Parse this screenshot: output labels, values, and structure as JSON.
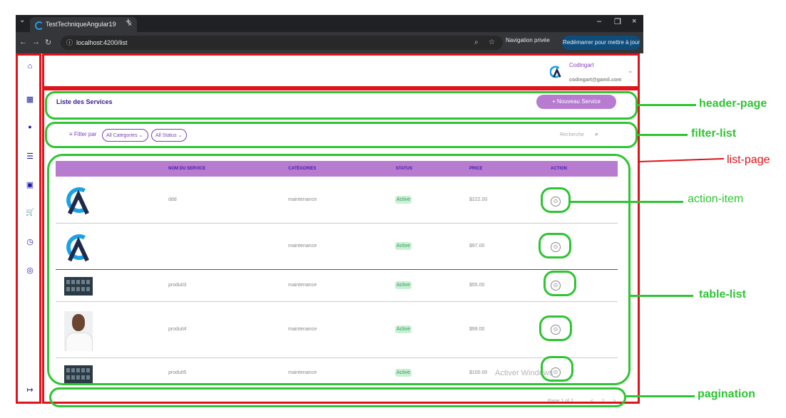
{
  "browser": {
    "tab_title": "TestTechniqueAngular19",
    "tab_menu": "⌄",
    "tab_close": "×",
    "new_tab": "+",
    "win_min": "–",
    "win_restore": "❐",
    "win_close": "×",
    "url": "localhost:4200/list",
    "back": "←",
    "forward": "→",
    "reload": "↻",
    "zoom": "⌕",
    "star": "☆",
    "private_label": "Navigation privée",
    "restart_label": "Redémarrer pour mettre à jour ⋮"
  },
  "sidebar": {
    "icons": [
      "home-icon",
      "dashboard-icon",
      "user-icon",
      "list-icon",
      "gallery-icon",
      "cart-icon",
      "clock-icon",
      "fingerprint-icon",
      "logout-icon"
    ],
    "glyphs": [
      "⌂",
      "▦",
      "●",
      "☰",
      "▣",
      "🛒",
      "◷",
      "◎",
      "↦"
    ]
  },
  "user": {
    "name": "Codingart",
    "email": "codingart@gamil.com",
    "chevron": "⌄"
  },
  "header": {
    "title": "Liste des Services",
    "new_button": "+ Nouveau Service"
  },
  "filters": {
    "label": "Filter par",
    "category": "All Categories",
    "status": "All Status",
    "search_placeholder": "Recherche",
    "filter_glyph": "≡",
    "search_glyph": "⌕"
  },
  "table": {
    "columns": [
      "NOM DU SERVICE",
      "CATÉGORIES",
      "STATUS",
      "PRICE",
      "ACTION"
    ],
    "rows": [
      {
        "image": "logo",
        "name": "ddd",
        "category": "maintenance",
        "status": "Active",
        "price": "$222.00"
      },
      {
        "image": "logo",
        "name": "",
        "category": "maintenance",
        "status": "Active",
        "price": "$97.00"
      },
      {
        "image": "screenshot",
        "name": "produit3",
        "category": "maintenance",
        "status": "Active",
        "price": "$55.00"
      },
      {
        "image": "person",
        "name": "produit4",
        "category": "maintenance",
        "status": "Active",
        "price": "$99.00"
      },
      {
        "image": "screenshot",
        "name": "produit5",
        "category": "maintenance",
        "status": "Active",
        "price": "$100.00"
      }
    ],
    "action_glyph": "⊙"
  },
  "watermark": "Activer Windows",
  "pagination": {
    "label": "Page 1 of 2",
    "prev": "<",
    "page": "1",
    "next": ">"
  },
  "annotations": {
    "header_page": "header-page",
    "filter_list": "filter-list",
    "list_page": "list-page",
    "action_item": "action-item",
    "table_list": "table-list",
    "pagination": "pagination"
  },
  "colors": {
    "accent": "#b77cd0",
    "brand_dark": "#3a1a8a",
    "annotation_green": "#2ec433",
    "annotation_red": "#e0131a"
  }
}
